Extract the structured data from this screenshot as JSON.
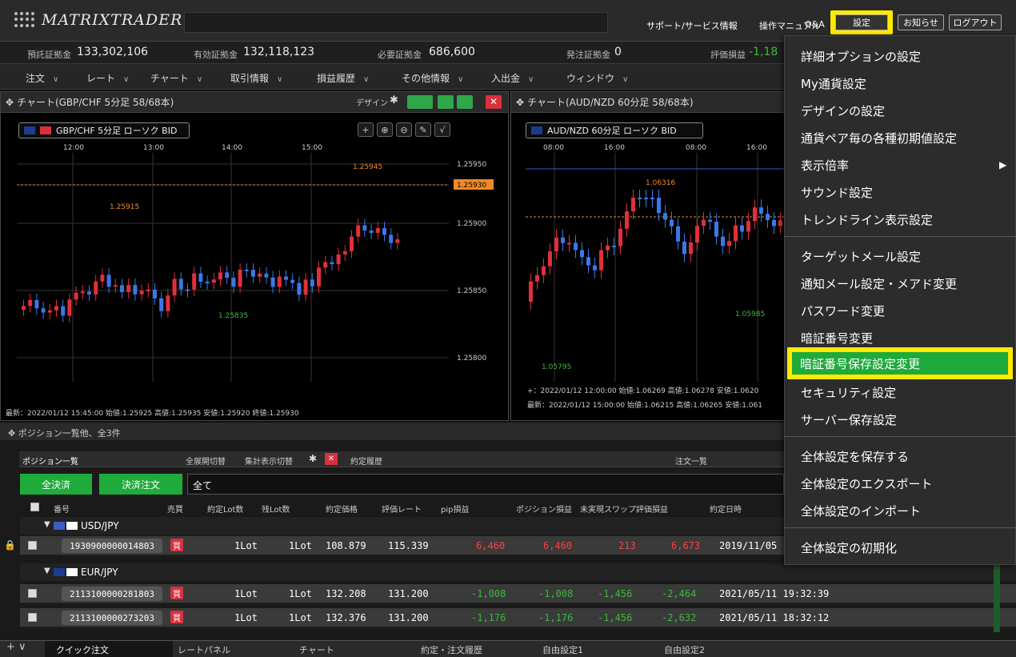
{
  "app": {
    "name": "MATRIXTRADER"
  },
  "header": {
    "links": [
      "サポート/サービス情報",
      "操作マニュアル",
      "Q&A"
    ],
    "buttons": {
      "settings": "設定",
      "notice": "お知らせ",
      "logout": "ログアウト"
    }
  },
  "margins": {
    "deposit_label": "預託証拠金",
    "deposit_value": "133,302,106",
    "effective_label": "有効証拠金",
    "effective_value": "132,118,123",
    "required_label": "必要証拠金",
    "required_value": "686,600",
    "order_label": "発注証拠金",
    "order_value": "0",
    "pl_label": "評価損益",
    "pl_value": "-1,18"
  },
  "menu": [
    "注文",
    "レート",
    "チャート",
    "取引情報",
    "損益履歴",
    "その他情報",
    "入出金",
    "ウィンドウ"
  ],
  "chart1": {
    "title": "チャート(GBP/CHF 5分足 58/68本)",
    "design_label": "デザイン",
    "symbol": "GBP/CHF 5分足 ローソク BID",
    "times": [
      "12:00",
      "13:00",
      "14:00",
      "15:00"
    ],
    "prices": [
      "1.25950",
      "1.25930",
      "1.25900",
      "1.25850",
      "1.25800"
    ],
    "annotations": {
      "high": "1.25945",
      "mid": "1.25915",
      "low": "1.25835"
    },
    "footer": "最新：2022/01/12 15:45:00 始値:1.25925 高値:1.25935 安値:1.25920 終値:1.25930"
  },
  "chart2": {
    "title": "チャート(AUD/NZD 60分足 58/68本)",
    "symbol": "AUD/NZD 60分足 ローソク BID",
    "times": [
      "08:00",
      "16:00",
      "08:00",
      "16:00"
    ],
    "annotations": {
      "high": "1.06316",
      "mid": "1.05985",
      "low": "1.05795"
    },
    "cursor": "+：2022/01/12 12:00:00 始値:1.06269 高値:1.06278 安値:1.0620",
    "footer": "最新：2022/01/12 15:00:00 始値:1.06215 高値:1.06265 安値:1.061"
  },
  "positions": {
    "header": "ポジション一覧他、全3件",
    "tab_label": "ポジション一覧",
    "expand_toggle": "全展開切替",
    "summary_toggle": "集計表示切替",
    "history_tab": "約定履歴",
    "orders_tab": "注文一覧",
    "close_all": "全決済",
    "close_order": "決済注文",
    "filter": "全て",
    "columns": [
      "番号",
      "売買",
      "約定Lot数",
      "残Lot数",
      "約定価格",
      "評価レート",
      "pip損益",
      "ポジション損益",
      "未実現スワップ",
      "評価損益",
      "約定日時"
    ],
    "groups": [
      {
        "pair": "USD/JPY",
        "rows": [
          {
            "id": "1930900000014803",
            "side": "買",
            "lot": "1Lot",
            "rem": "1Lot",
            "price": "108.879",
            "rate": "115.339",
            "pip": "6,460",
            "pos": "6,460",
            "swap": "213",
            "pl": "6,673",
            "date": "2019/11/05"
          }
        ]
      },
      {
        "pair": "EUR/JPY",
        "rows": [
          {
            "id": "2113100000281803",
            "side": "買",
            "lot": "1Lot",
            "rem": "1Lot",
            "price": "132.208",
            "rate": "131.200",
            "pip": "-1,008",
            "pos": "-1,008",
            "swap": "-1,456",
            "pl": "-2,464",
            "date": "2021/05/11 19:32:39"
          },
          {
            "id": "2113100000273203",
            "side": "買",
            "lot": "1Lot",
            "rem": "1Lot",
            "price": "132.376",
            "rate": "131.200",
            "pip": "-1,176",
            "pos": "-1,176",
            "swap": "-1,456",
            "pl": "-2,632",
            "date": "2021/05/11 18:32:12"
          }
        ]
      }
    ]
  },
  "bottom_tabs": [
    "クイック注文",
    "レートパネル",
    "チャート",
    "約定・注文履歴",
    "自由設定1",
    "自由設定2"
  ],
  "dropdown": {
    "items": [
      "詳細オプションの設定",
      "My通貨設定",
      "デザインの設定",
      "通貨ペア毎の各種初期値設定",
      "表示倍率",
      "サウンド設定",
      "トレンドライン表示設定",
      "ターゲットメール設定",
      "通知メール設定・メアド変更",
      "パスワード変更",
      "暗証番号変更",
      "暗証番号保存設定変更",
      "セキュリティ設定",
      "サーバー保存設定",
      "全体設定を保存する",
      "全体設定のエクスポート",
      "全体設定のインポート",
      "全体設定の初期化"
    ],
    "submenu_arrow": "▶"
  },
  "colors": {
    "accent_yellow": "#ffea00",
    "highlight_green": "#1faa3c",
    "candle_up": "#e0303a",
    "candle_down": "#3a78e8",
    "profit": "#ff4040",
    "loss": "#3cb83c"
  }
}
